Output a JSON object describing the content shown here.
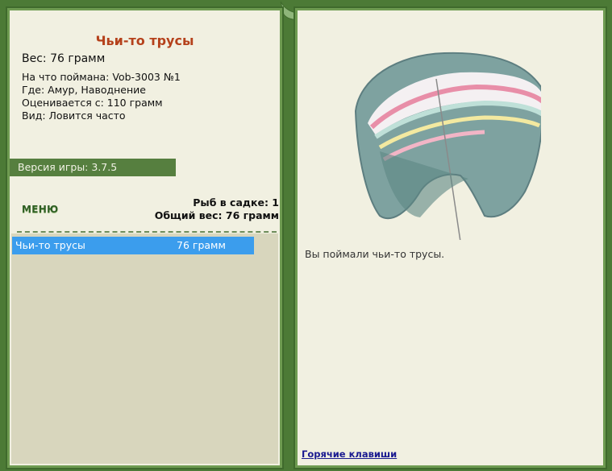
{
  "item": {
    "title": "Чьи-то трусы",
    "weight": "Вес: 76 грамм",
    "caught_on": "На что поймана: Vob-3003 №1",
    "where": "Где: Амур, Наводнение",
    "value": "Оценивается с: 110 грамм",
    "kind": "Вид: Ловится часто"
  },
  "version": "Версия игры: 3.7.5",
  "menu": "МЕНЮ",
  "stats": {
    "fish_count": "Рыб в садке: 1",
    "total_weight": "Общий вес: 76 грамм"
  },
  "list": [
    {
      "name": "Чьи-то трусы",
      "weight": "76 грамм"
    }
  ],
  "message": "Вы поймали чьи-то трусы.",
  "hotkeys": "Горячие клавиши",
  "colors": {
    "frame": "#4c7a36",
    "panel": "#f1f0e1",
    "title": "#b5411b",
    "selection": "#3b9ded"
  }
}
